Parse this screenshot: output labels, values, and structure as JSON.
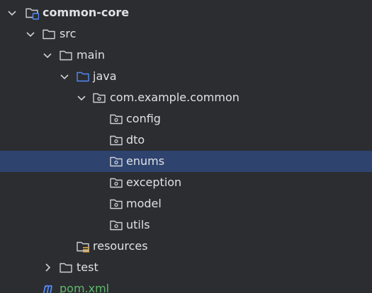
{
  "project_tree": {
    "root": {
      "label": "common-core",
      "icon": "module-folder-icon",
      "expanded": true
    },
    "src": {
      "label": "src",
      "icon": "folder-icon",
      "expanded": true
    },
    "main": {
      "label": "main",
      "icon": "folder-icon",
      "expanded": true
    },
    "java": {
      "label": "java",
      "icon": "source-root-folder-icon",
      "expanded": true
    },
    "package": {
      "label": "com.example.common",
      "icon": "package-folder-icon",
      "expanded": true
    },
    "packages": [
      {
        "label": "config",
        "icon": "package-folder-icon",
        "selected": false
      },
      {
        "label": "dto",
        "icon": "package-folder-icon",
        "selected": false
      },
      {
        "label": "enums",
        "icon": "package-folder-icon",
        "selected": true
      },
      {
        "label": "exception",
        "icon": "package-folder-icon",
        "selected": false
      },
      {
        "label": "model",
        "icon": "package-folder-icon",
        "selected": false
      },
      {
        "label": "utils",
        "icon": "package-folder-icon",
        "selected": false
      }
    ],
    "resources": {
      "label": "resources",
      "icon": "resources-folder-icon"
    },
    "test": {
      "label": "test",
      "icon": "folder-icon",
      "expanded": false
    },
    "pom": {
      "label": "pom.xml",
      "icon": "maven-icon"
    }
  },
  "colors": {
    "background": "#2b2d30",
    "selection": "#2e436e",
    "text": "#dfe1e5",
    "icon_gray": "#ced0d6",
    "source_root_blue": "#548af7",
    "resources_accent": "#d9a343",
    "maven_file_text": "#5fb86a"
  }
}
